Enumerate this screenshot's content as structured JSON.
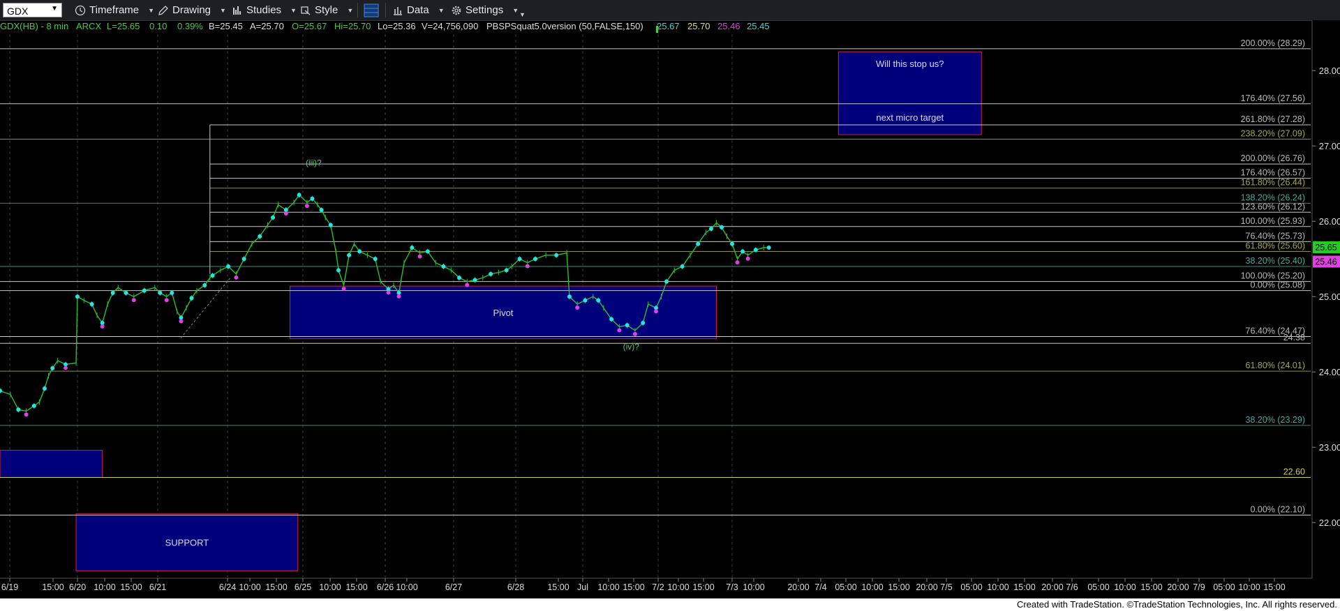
{
  "toolbar": {
    "symbol": "GDX",
    "menus": [
      {
        "id": "timeframe",
        "label": "Timeframe",
        "icon": "clock-icon"
      },
      {
        "id": "drawing",
        "label": "Drawing",
        "icon": "pencil-icon"
      },
      {
        "id": "studies",
        "label": "Studies",
        "icon": "studies-icon"
      },
      {
        "id": "style",
        "label": "Style",
        "icon": "style-icon"
      },
      {
        "id": "data",
        "label": "Data",
        "icon": "data-bars-icon"
      },
      {
        "id": "settings",
        "label": "Settings",
        "icon": "gear-icon"
      }
    ]
  },
  "infobar": {
    "symbol_interval": "GDX(HB) - 8 min",
    "exchange": "ARCX",
    "last": "L=25.65",
    "change": "0.10",
    "change_pct": "0.39%",
    "bid": "B=25.45",
    "ask": "A=25.70",
    "open": "O=25.67",
    "high": "Hi=25.70",
    "low": "Lo=25.36",
    "volume": "V=24,756,090",
    "study": "PBSPSquat5.0version (50,FALSE,150)",
    "study_values": [
      "25.67",
      "25.70",
      "25.46",
      "25.45"
    ]
  },
  "colors": {
    "background": "#000000",
    "up_green": "#44cc44",
    "candle_green": "#2bbf2b",
    "cyan_dot": "#22e6e6",
    "magenta_dot": "#e040e0",
    "box_fill": "#00007a",
    "box_border": "#d0203a",
    "fib_white": "#c8c8c8",
    "fib_yellow": "#cfcf5a",
    "fib_olive": "#8f8f3a",
    "fib_teal": "#2f8f80",
    "fib_label": "#b8b8b8",
    "grid_dash": "#3a3a3a",
    "price_badge_green": "#1fd11f",
    "price_badge_magenta": "#e040e0"
  },
  "chart_data": {
    "type": "candlestick",
    "title": "",
    "x_tick_labels": [
      "6/19",
      "15:00",
      "6/20",
      "10:00",
      "15:00",
      "6/21",
      "6/24",
      "10:00",
      "15:00",
      "6/25",
      "10:00",
      "15:00",
      "6/26",
      "10:00",
      "6/27",
      "6/28",
      "15:00",
      "Jul",
      "10:00",
      "15:00",
      "7/2",
      "10:00",
      "15:00",
      "7/3",
      "10:00",
      "20:00",
      "7/4",
      "05:00",
      "10:00",
      "15:00",
      "20:00",
      "7/5",
      "05:00",
      "10:00",
      "15:00",
      "20:00",
      "7/6",
      "05:00",
      "10:00",
      "15:00",
      "20:00",
      "7/9",
      "05:00",
      "10:00",
      "15:00"
    ],
    "y_ticks": [
      "28.00",
      "27.00",
      "26.00",
      "25.00",
      "24.00",
      "23.00",
      "22.00"
    ],
    "ylim": [
      21.6,
      28.5
    ],
    "last_price_badges": [
      "25.65",
      "25.46"
    ],
    "fib_levels": [
      {
        "label": "200.00% (28.29)",
        "value": 28.29,
        "color": "white",
        "x_start": 0
      },
      {
        "label": "176.40% (27.56)",
        "value": 27.56,
        "color": "white",
        "x_start": 0
      },
      {
        "label": "261.80% (27.28)",
        "value": 27.28,
        "color": "white",
        "x_start": 0.16
      },
      {
        "label": "238.20% (27.09)",
        "value": 27.09,
        "color": "olive",
        "x_start": 0
      },
      {
        "label": "200.00% (26.76)",
        "value": 26.76,
        "color": "white",
        "x_start": 0.16
      },
      {
        "label": "176.40% (26.57)",
        "value": 26.57,
        "color": "white",
        "x_start": 0.16
      },
      {
        "label": "161.80% (26.44)",
        "value": 26.44,
        "color": "olive",
        "x_start": 0.16
      },
      {
        "label": "138.20% (26.24)",
        "value": 26.24,
        "color": "teal",
        "x_start": 0
      },
      {
        "label": "123.60% (26.12)",
        "value": 26.12,
        "color": "white",
        "x_start": 0.16
      },
      {
        "label": "100.00% (25.93)",
        "value": 25.93,
        "color": "white",
        "x_start": 0.16
      },
      {
        "label": "76.40% (25.73)",
        "value": 25.73,
        "color": "white",
        "x_start": 0.16
      },
      {
        "label": "61.80% (25.60)",
        "value": 25.6,
        "color": "olive",
        "x_start": 0.16
      },
      {
        "label": "38.20% (25.40)",
        "value": 25.4,
        "color": "teal",
        "x_start": 0
      },
      {
        "label": "100.00% (25.20)",
        "value": 25.2,
        "color": "white",
        "x_start": 0
      },
      {
        "label": "0.00% (25.08)",
        "value": 25.08,
        "color": "white",
        "x_start": 0
      },
      {
        "label": "76.40% (24.47)",
        "value": 24.47,
        "color": "white",
        "x_start": 0
      },
      {
        "label": "24.38",
        "value": 24.38,
        "color": "white",
        "x_start": 0
      },
      {
        "label": "61.80% (24.01)",
        "value": 24.01,
        "color": "olive",
        "x_start": 0
      },
      {
        "label": "38.20% (23.29)",
        "value": 23.29,
        "color": "teal",
        "x_start": 0
      },
      {
        "label": "22.60",
        "value": 22.6,
        "color": "yellow",
        "x_start": 0
      },
      {
        "label": "0.00% (22.10)",
        "value": 22.1,
        "color": "white",
        "x_start": 0
      }
    ],
    "boxes": [
      {
        "label": "Will this stop us?",
        "label2": "next micro target",
        "x0": 0.639,
        "x1": 0.748,
        "y_top": 28.25,
        "y_bottom": 27.15
      },
      {
        "label": "Pivot",
        "label2": "",
        "x0": 0.221,
        "x1": 0.546,
        "y_top": 25.14,
        "y_bottom": 24.44
      },
      {
        "label": "",
        "label2": "",
        "x0": 0.0,
        "x1": 0.078,
        "y_top": 22.96,
        "y_bottom": 22.6
      },
      {
        "label": "SUPPORT",
        "label2": "",
        "x0": 0.058,
        "x1": 0.227,
        "y_top": 22.12,
        "y_bottom": 21.36
      }
    ],
    "annotations": [
      {
        "text": "(iii)?",
        "x": 0.239,
        "y": 26.74
      },
      {
        "text": "(iv)?",
        "x": 0.481,
        "y": 24.3
      }
    ],
    "price_path": [
      [
        0.0,
        23.75
      ],
      [
        0.008,
        23.7
      ],
      [
        0.014,
        23.5
      ],
      [
        0.02,
        23.48
      ],
      [
        0.026,
        23.55
      ],
      [
        0.03,
        23.6
      ],
      [
        0.034,
        23.78
      ],
      [
        0.037,
        23.95
      ],
      [
        0.04,
        24.05
      ],
      [
        0.044,
        24.15
      ],
      [
        0.05,
        24.1
      ],
      [
        0.058,
        24.12
      ],
      [
        0.059,
        25.0
      ],
      [
        0.064,
        24.95
      ],
      [
        0.07,
        24.9
      ],
      [
        0.074,
        24.75
      ],
      [
        0.078,
        24.65
      ],
      [
        0.082,
        24.9
      ],
      [
        0.086,
        25.05
      ],
      [
        0.09,
        25.12
      ],
      [
        0.096,
        25.05
      ],
      [
        0.102,
        25.0
      ],
      [
        0.11,
        25.08
      ],
      [
        0.118,
        25.12
      ],
      [
        0.122,
        25.05
      ],
      [
        0.127,
        25.0
      ],
      [
        0.131,
        25.05
      ],
      [
        0.135,
        24.8
      ],
      [
        0.138,
        24.72
      ],
      [
        0.142,
        24.85
      ],
      [
        0.146,
        24.98
      ],
      [
        0.15,
        25.08
      ],
      [
        0.156,
        25.15
      ],
      [
        0.16,
        25.25
      ],
      [
        0.162,
        25.28
      ],
      [
        0.168,
        25.35
      ],
      [
        0.174,
        25.4
      ],
      [
        0.18,
        25.3
      ],
      [
        0.186,
        25.5
      ],
      [
        0.192,
        25.7
      ],
      [
        0.198,
        25.8
      ],
      [
        0.204,
        25.95
      ],
      [
        0.208,
        26.05
      ],
      [
        0.212,
        26.22
      ],
      [
        0.218,
        26.15
      ],
      [
        0.224,
        26.25
      ],
      [
        0.228,
        26.35
      ],
      [
        0.234,
        26.25
      ],
      [
        0.238,
        26.3
      ],
      [
        0.242,
        26.22
      ],
      [
        0.245,
        26.15
      ],
      [
        0.248,
        26.05
      ],
      [
        0.252,
        25.95
      ],
      [
        0.256,
        25.6
      ],
      [
        0.258,
        25.35
      ],
      [
        0.262,
        25.15
      ],
      [
        0.266,
        25.55
      ],
      [
        0.27,
        25.7
      ],
      [
        0.274,
        25.6
      ],
      [
        0.28,
        25.55
      ],
      [
        0.286,
        25.5
      ],
      [
        0.29,
        25.2
      ],
      [
        0.296,
        25.1
      ],
      [
        0.3,
        25.15
      ],
      [
        0.304,
        25.05
      ],
      [
        0.308,
        25.45
      ],
      [
        0.314,
        25.65
      ],
      [
        0.32,
        25.58
      ],
      [
        0.326,
        25.6
      ],
      [
        0.332,
        25.45
      ],
      [
        0.338,
        25.4
      ],
      [
        0.344,
        25.35
      ],
      [
        0.35,
        25.25
      ],
      [
        0.356,
        25.2
      ],
      [
        0.362,
        25.22
      ],
      [
        0.368,
        25.25
      ],
      [
        0.374,
        25.3
      ],
      [
        0.38,
        25.32
      ],
      [
        0.386,
        25.35
      ],
      [
        0.39,
        25.4
      ],
      [
        0.396,
        25.5
      ],
      [
        0.402,
        25.45
      ],
      [
        0.408,
        25.5
      ],
      [
        0.416,
        25.55
      ],
      [
        0.424,
        25.55
      ],
      [
        0.432,
        25.58
      ],
      [
        0.434,
        25.0
      ],
      [
        0.44,
        24.9
      ],
      [
        0.446,
        24.95
      ],
      [
        0.452,
        25.0
      ],
      [
        0.456,
        24.95
      ],
      [
        0.46,
        24.85
      ],
      [
        0.466,
        24.7
      ],
      [
        0.472,
        24.6
      ],
      [
        0.478,
        24.62
      ],
      [
        0.484,
        24.55
      ],
      [
        0.49,
        24.65
      ],
      [
        0.494,
        24.9
      ],
      [
        0.5,
        24.85
      ],
      [
        0.504,
        25.0
      ],
      [
        0.508,
        25.2
      ],
      [
        0.514,
        25.35
      ],
      [
        0.52,
        25.4
      ],
      [
        0.526,
        25.55
      ],
      [
        0.532,
        25.7
      ],
      [
        0.538,
        25.85
      ],
      [
        0.542,
        25.9
      ],
      [
        0.546,
        25.98
      ],
      [
        0.55,
        25.92
      ],
      [
        0.554,
        25.8
      ],
      [
        0.558,
        25.7
      ],
      [
        0.562,
        25.5
      ],
      [
        0.566,
        25.6
      ],
      [
        0.57,
        25.55
      ],
      [
        0.576,
        25.62
      ],
      [
        0.582,
        25.65
      ],
      [
        0.586,
        25.65
      ]
    ]
  }
}
